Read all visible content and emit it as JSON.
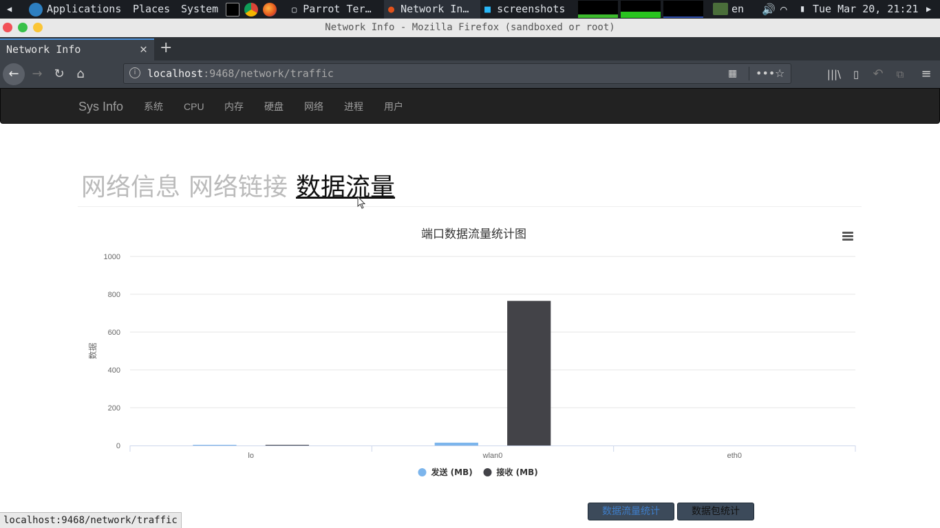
{
  "panel": {
    "applications": "Applications",
    "places": "Places",
    "system": "System",
    "tasks": [
      "Parrot Ter…",
      "Network In…",
      "screenshots"
    ],
    "lang": "en",
    "clock": "Tue Mar 20, 21:21"
  },
  "window": {
    "title": "Network Info - Mozilla Firefox (sandboxed or root)"
  },
  "browser": {
    "tab_title": "Network Info",
    "url_host": "localhost",
    "url_rest": ":9468/network/traffic",
    "status_url": "localhost:9468/network/traffic"
  },
  "site": {
    "brand": "Sys Info",
    "nav": [
      "系统",
      "CPU",
      "内存",
      "硬盘",
      "网络",
      "进程",
      "用户"
    ],
    "page_tabs": [
      "网络信息",
      "网络链接",
      "数据流量"
    ],
    "buttons": [
      "数据流量统计",
      "数据包统计"
    ]
  },
  "colors": {
    "sent": "#7cb5ec",
    "received": "#434348",
    "active_button_text": "#3f7ec9",
    "button_text": "#111111"
  },
  "chart_data": {
    "type": "bar",
    "title": "端口数据流量统计图",
    "ylabel": "数据",
    "xlabel": "",
    "categories": [
      "lo",
      "wlan0",
      "eth0"
    ],
    "ylim": [
      0,
      1000
    ],
    "yticks": [
      0,
      200,
      400,
      600,
      800,
      1000
    ],
    "grid": true,
    "legend": "bottom-center",
    "series": [
      {
        "name": "发送 (MB)",
        "values": [
          3,
          15,
          0
        ]
      },
      {
        "name": "接收 (MB)",
        "values": [
          3,
          765,
          0
        ]
      }
    ]
  }
}
